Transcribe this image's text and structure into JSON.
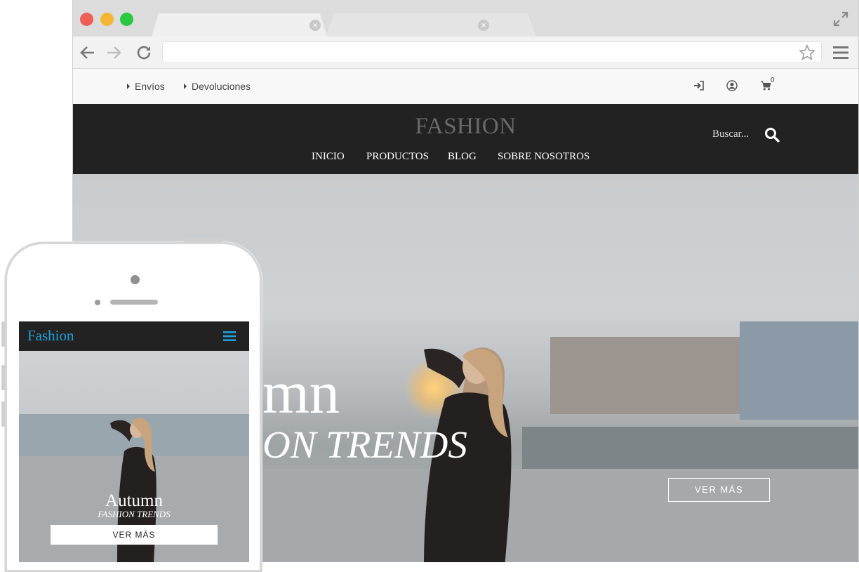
{
  "browser": {
    "url": ""
  },
  "site": {
    "topbar": {
      "links": [
        "Envíos",
        "Devoluciones"
      ],
      "cart_count": "0"
    },
    "brand": "FASHION",
    "nav": [
      "INICIO",
      "PRODUCTOS",
      "BLOG",
      "SOBRE NOSOTROS"
    ],
    "search_placeholder": "Buscar...",
    "hero": {
      "title": "mn",
      "subtitle": "ON TRENDS",
      "button": "VER MÁS"
    }
  },
  "mobile": {
    "brand": "Fashion",
    "hero": {
      "title": "Autumn",
      "subtitle": "FASHION TRENDS",
      "button": "VER MÁS"
    }
  },
  "colors": {
    "header_bg": "#222222",
    "mobile_brand": "#1ea1d8",
    "traffic_red": "#ee5f58",
    "traffic_yellow": "#f3b633",
    "traffic_green": "#28c840"
  },
  "icons": [
    "back-arrow-icon",
    "forward-arrow-icon",
    "reload-icon",
    "star-icon",
    "hamburger-menu-icon",
    "expand-icon",
    "tab-close-icon",
    "sign-in-icon",
    "user-icon",
    "cart-icon",
    "search-icon"
  ]
}
